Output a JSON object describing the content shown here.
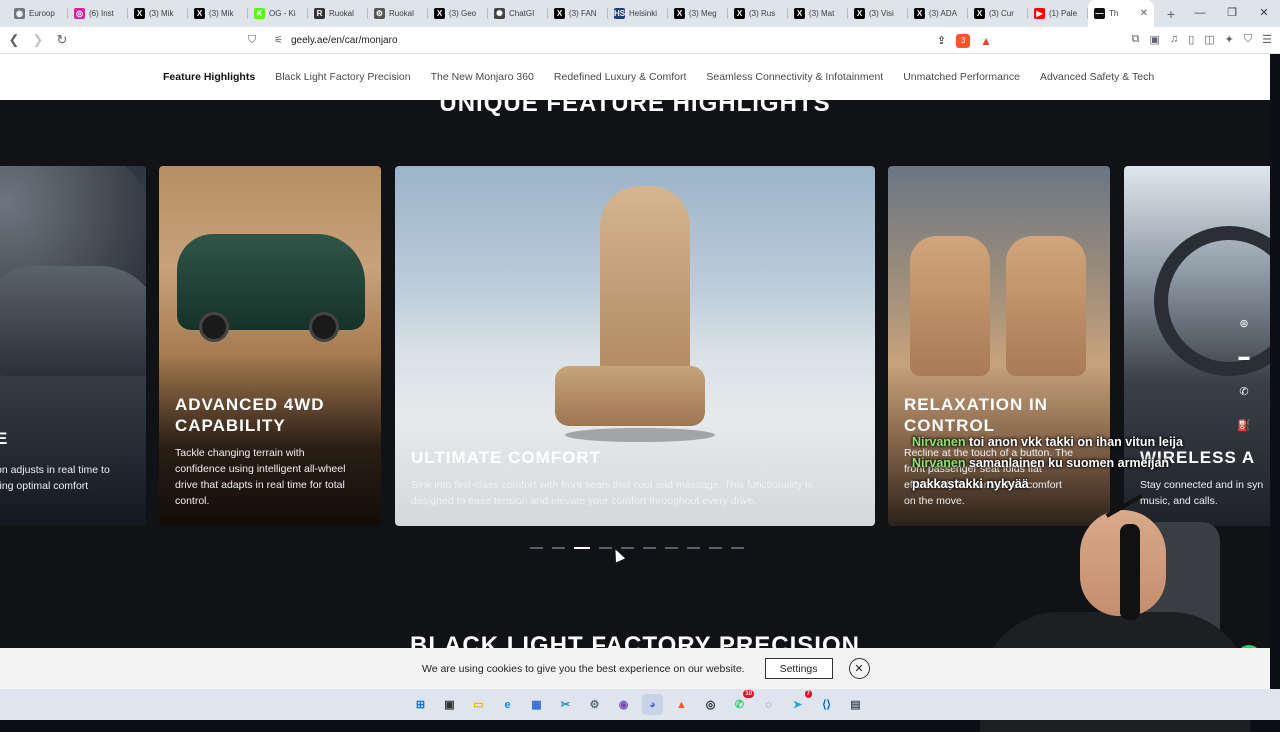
{
  "browser": {
    "tabs": [
      {
        "label": "Euroop",
        "icon": "globe-icon",
        "color": "#6e7681",
        "glyph": "◉"
      },
      {
        "label": "(6) Inst",
        "icon": "instagram-icon",
        "color": "#d6249f",
        "glyph": "◎"
      },
      {
        "label": "(3) Mik",
        "icon": "x-icon",
        "color": "#000000",
        "glyph": "X"
      },
      {
        "label": "(3) Mik",
        "icon": "x-icon",
        "color": "#000000",
        "glyph": "X"
      },
      {
        "label": "OG - Ki",
        "icon": "kick-icon",
        "color": "#53fc18",
        "glyph": "K"
      },
      {
        "label": "Ruokal",
        "icon": "site-icon",
        "color": "#333333",
        "glyph": "R"
      },
      {
        "label": "Ruokal",
        "icon": "gear-icon",
        "color": "#555555",
        "glyph": "⚙"
      },
      {
        "label": "(3) Geo",
        "icon": "x-icon",
        "color": "#000000",
        "glyph": "X"
      },
      {
        "label": "ChatGI",
        "icon": "chatgpt-icon",
        "color": "#444444",
        "glyph": "✺"
      },
      {
        "label": "(3) FAN",
        "icon": "x-icon",
        "color": "#000000",
        "glyph": "X"
      },
      {
        "label": "Helsinki",
        "icon": "hs-icon",
        "color": "#1f3f7a",
        "glyph": "HS"
      },
      {
        "label": "(3) Meg",
        "icon": "x-icon",
        "color": "#000000",
        "glyph": "X"
      },
      {
        "label": "(3) Rus",
        "icon": "x-icon",
        "color": "#000000",
        "glyph": "X"
      },
      {
        "label": "(3) Mat",
        "icon": "x-icon",
        "color": "#000000",
        "glyph": "X"
      },
      {
        "label": "(3) Visi",
        "icon": "x-icon",
        "color": "#000000",
        "glyph": "X"
      },
      {
        "label": "(3) ADA",
        "icon": "x-icon",
        "color": "#000000",
        "glyph": "X"
      },
      {
        "label": "(3) Cur",
        "icon": "x-icon",
        "color": "#000000",
        "glyph": "X"
      },
      {
        "label": "(1) Pale",
        "icon": "youtube-icon",
        "color": "#ff0000",
        "glyph": "▶"
      },
      {
        "label": "Th",
        "icon": "geely-icon",
        "color": "#111111",
        "glyph": "—",
        "active": true
      }
    ],
    "new_tab": "+",
    "window_controls": [
      "—",
      "❐",
      "✕"
    ],
    "url": "geely.ae/en/car/monjaro",
    "shield_count": "3"
  },
  "site_nav": {
    "items": [
      {
        "label": "Feature Highlights",
        "active": true
      },
      {
        "label": "Black Light Factory Precision"
      },
      {
        "label": "The New Monjaro 360"
      },
      {
        "label": "Redefined Luxury & Comfort"
      },
      {
        "label": "Seamless Connectivity & Infotainment"
      },
      {
        "label": "Unmatched Performance"
      },
      {
        "label": "Advanced Safety & Tech"
      }
    ]
  },
  "section": {
    "title": "UNIQUE FEATURE HIGHLIGHTS",
    "next_title": "BLACK LIGHT FACTORY PRECISION"
  },
  "cards": {
    "c1": {
      "title": "E",
      "desc": "on adjusts in real time to\nring optimal comfort"
    },
    "c2": {
      "title": "ADVANCED 4WD\nCAPABILITY",
      "desc": "Tackle changing terrain with\nconfidence using intelligent all-wheel\ndrive that adapts in real time for total\ncontrol."
    },
    "c3": {
      "title": "ULTIMATE COMFORT",
      "desc": "Sink into first-class comfort with front seats that cool and massage. This functionality is\ndesigned to ease tension and elevate your comfort throughout every drive."
    },
    "c4": {
      "title": "RELAXATION IN\nCONTROL",
      "desc": "Recline at the touch of a button. The\nfront passenger seat folds flat\neffortlessly for unmatched comfort\non the move."
    },
    "c5": {
      "title": "WIRELESS A",
      "desc": "Stay connected and in syn\nmusic, and calls."
    }
  },
  "carousel": {
    "count": 10,
    "active_index": 2
  },
  "fab_rail": [
    {
      "icon": "steering-wheel-icon",
      "glyph": "⊛"
    },
    {
      "icon": "chat-icon",
      "glyph": "▬"
    },
    {
      "icon": "phone-icon",
      "glyph": "✆"
    },
    {
      "icon": "fuel-pump-icon",
      "glyph": "⛽"
    }
  ],
  "chat_overlay": {
    "lines": [
      {
        "nick": "Nirvanen",
        "text": "toi anon vkk takki on ihan vitun leija"
      },
      {
        "nick": "Nirvanen",
        "text": "samanlainen ku suomen armeijan\npakkastakki nykyää"
      }
    ]
  },
  "whatsapp_icon": "✆",
  "cookie": {
    "text": "We are using cookies to give you the best experience on our website.",
    "settings_label": "Settings",
    "close_glyph": "✕"
  },
  "taskbar": {
    "items": [
      {
        "icon": "windows-start-icon",
        "glyph": "⊞",
        "color": "#0078d4"
      },
      {
        "icon": "task-view-icon",
        "glyph": "▣",
        "color": "#333333"
      },
      {
        "icon": "file-explorer-icon",
        "glyph": "▭",
        "color": "#f2b600"
      },
      {
        "icon": "edge-icon",
        "glyph": "e",
        "color": "#0c8fd8"
      },
      {
        "icon": "store-icon",
        "glyph": "▦",
        "color": "#2c6bd1"
      },
      {
        "icon": "snipping-icon",
        "glyph": "✂",
        "color": "#1a8fb0"
      },
      {
        "icon": "settings-icon",
        "glyph": "⚙",
        "color": "#5b6b7a"
      },
      {
        "icon": "app-icon",
        "glyph": "◉",
        "color": "#7a4dbb"
      },
      {
        "icon": "discord-icon",
        "glyph": "◕",
        "color": "#5865f2",
        "active": true
      },
      {
        "icon": "brave-icon",
        "glyph": "▲",
        "color": "#fb542b"
      },
      {
        "icon": "steam-icon",
        "glyph": "◎",
        "color": "#1b2838"
      },
      {
        "icon": "whatsapp-icon",
        "glyph": "✆",
        "color": "#25d366",
        "badge": "10"
      },
      {
        "icon": "app-icon-2",
        "glyph": "◌",
        "color": "#3b3f9e"
      },
      {
        "icon": "telegram-icon",
        "glyph": "➤",
        "color": "#2aa3e0",
        "badge": "7"
      },
      {
        "icon": "vscode-icon",
        "glyph": "⟨⟩",
        "color": "#0066b8"
      },
      {
        "icon": "calculator-icon",
        "glyph": "▤",
        "color": "#4a5565"
      }
    ]
  }
}
